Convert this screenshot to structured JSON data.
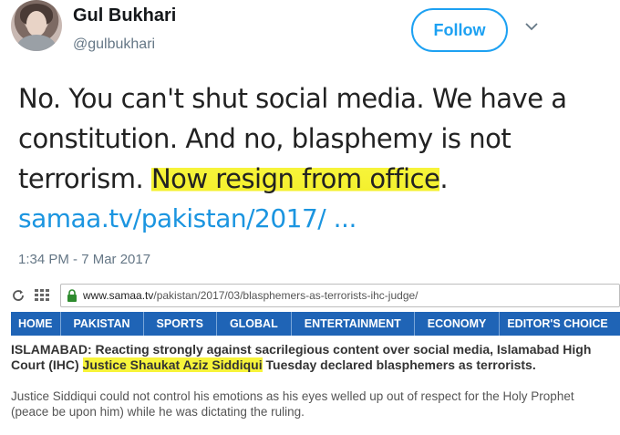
{
  "tweet": {
    "display_name": "Gul Bukhari",
    "handle": "@gulbukhari",
    "follow_label": "Follow",
    "text_part1": "No. You can't shut social media. We have a constitution. And no, blasphemy is not terrorism. ",
    "text_highlight": "Now resign from office",
    "text_part2": ".",
    "link": "samaa.tv/pakistan/2017/ ...",
    "timestamp": "1:34 PM - 7 Mar 2017"
  },
  "browser": {
    "url_domain": "www.samaa.tv",
    "url_path": "/pakistan/2017/03/blasphemers-as-terrorists-ihc-judge/",
    "nav_items": [
      "HOME",
      "PAKISTAN",
      "SPORTS",
      "GLOBAL",
      "ENTERTAINMENT",
      "ECONOMY",
      "EDITOR'S CHOICE"
    ]
  },
  "article": {
    "lead_part1": "ISLAMABAD: Reacting strongly against sacrilegious content over social media, Islamabad High Court (IHC) ",
    "lead_highlight": "Justice Shaukat Aziz Siddiqui",
    "lead_part2": " Tuesday declared blasphemers as terrorists.",
    "body": "Justice Siddiqui could not control his emotions as his  eyes welled up out of respect for the Holy Prophet (peace be upon him) while he was dictating the ruling."
  },
  "colors": {
    "follow_blue": "#1da1f2",
    "link_blue": "#1b95e0",
    "highlight_yellow": "#f7f43a",
    "nav_blue": "#1f64b6"
  }
}
